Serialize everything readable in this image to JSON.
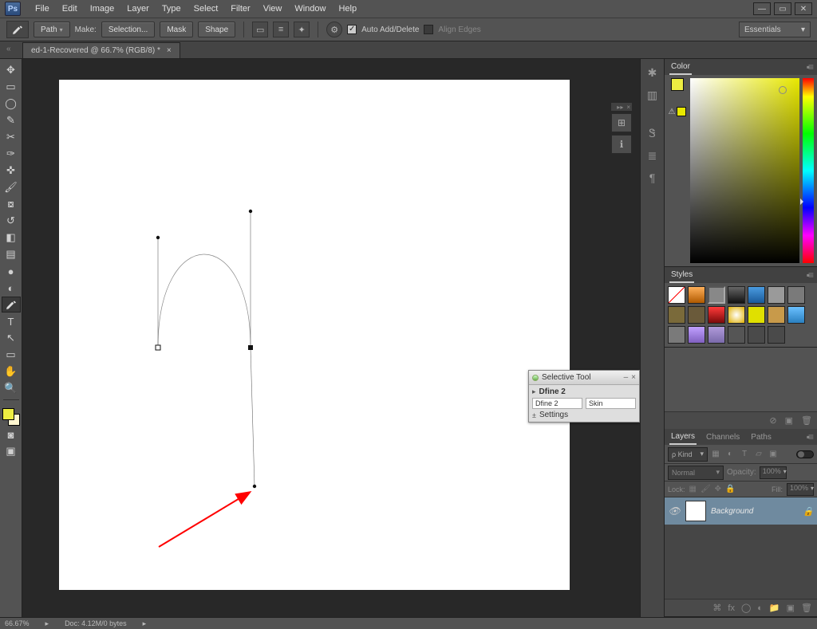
{
  "menu": {
    "items": [
      "File",
      "Edit",
      "Image",
      "Layer",
      "Type",
      "Select",
      "Filter",
      "View",
      "Window",
      "Help"
    ]
  },
  "options": {
    "mode": "Path",
    "make_label": "Make:",
    "selection_btn": "Selection...",
    "mask_btn": "Mask",
    "shape_btn": "Shape",
    "auto_label": "Auto Add/Delete",
    "align_label": "Align Edges",
    "workspace": "Essentials"
  },
  "tab": {
    "title": "ed-1-Recovered @ 66.7% (RGB/8) *"
  },
  "colors": {
    "foreground": "#EDED42",
    "background": "#FFF6D0"
  },
  "panels": {
    "color_tab": "Color",
    "styles_tab": "Styles",
    "layers_tabs": [
      "Layers",
      "Channels",
      "Paths"
    ],
    "filter_kind": "ρ Kind",
    "blend_mode": "Normal",
    "opacity_label": "Opacity:",
    "opacity_value": "100%",
    "lock_label": "Lock:",
    "fill_label": "Fill:",
    "fill_value": "100%",
    "layer_name": "Background"
  },
  "selective": {
    "title": "Selective Tool",
    "plugin": "Dfine 2",
    "row1": "Dfine 2",
    "row2": "Skin",
    "settings": "Settings"
  },
  "status": {
    "zoom": "66.67%",
    "doc": "Doc: 4.12M/0 bytes"
  }
}
